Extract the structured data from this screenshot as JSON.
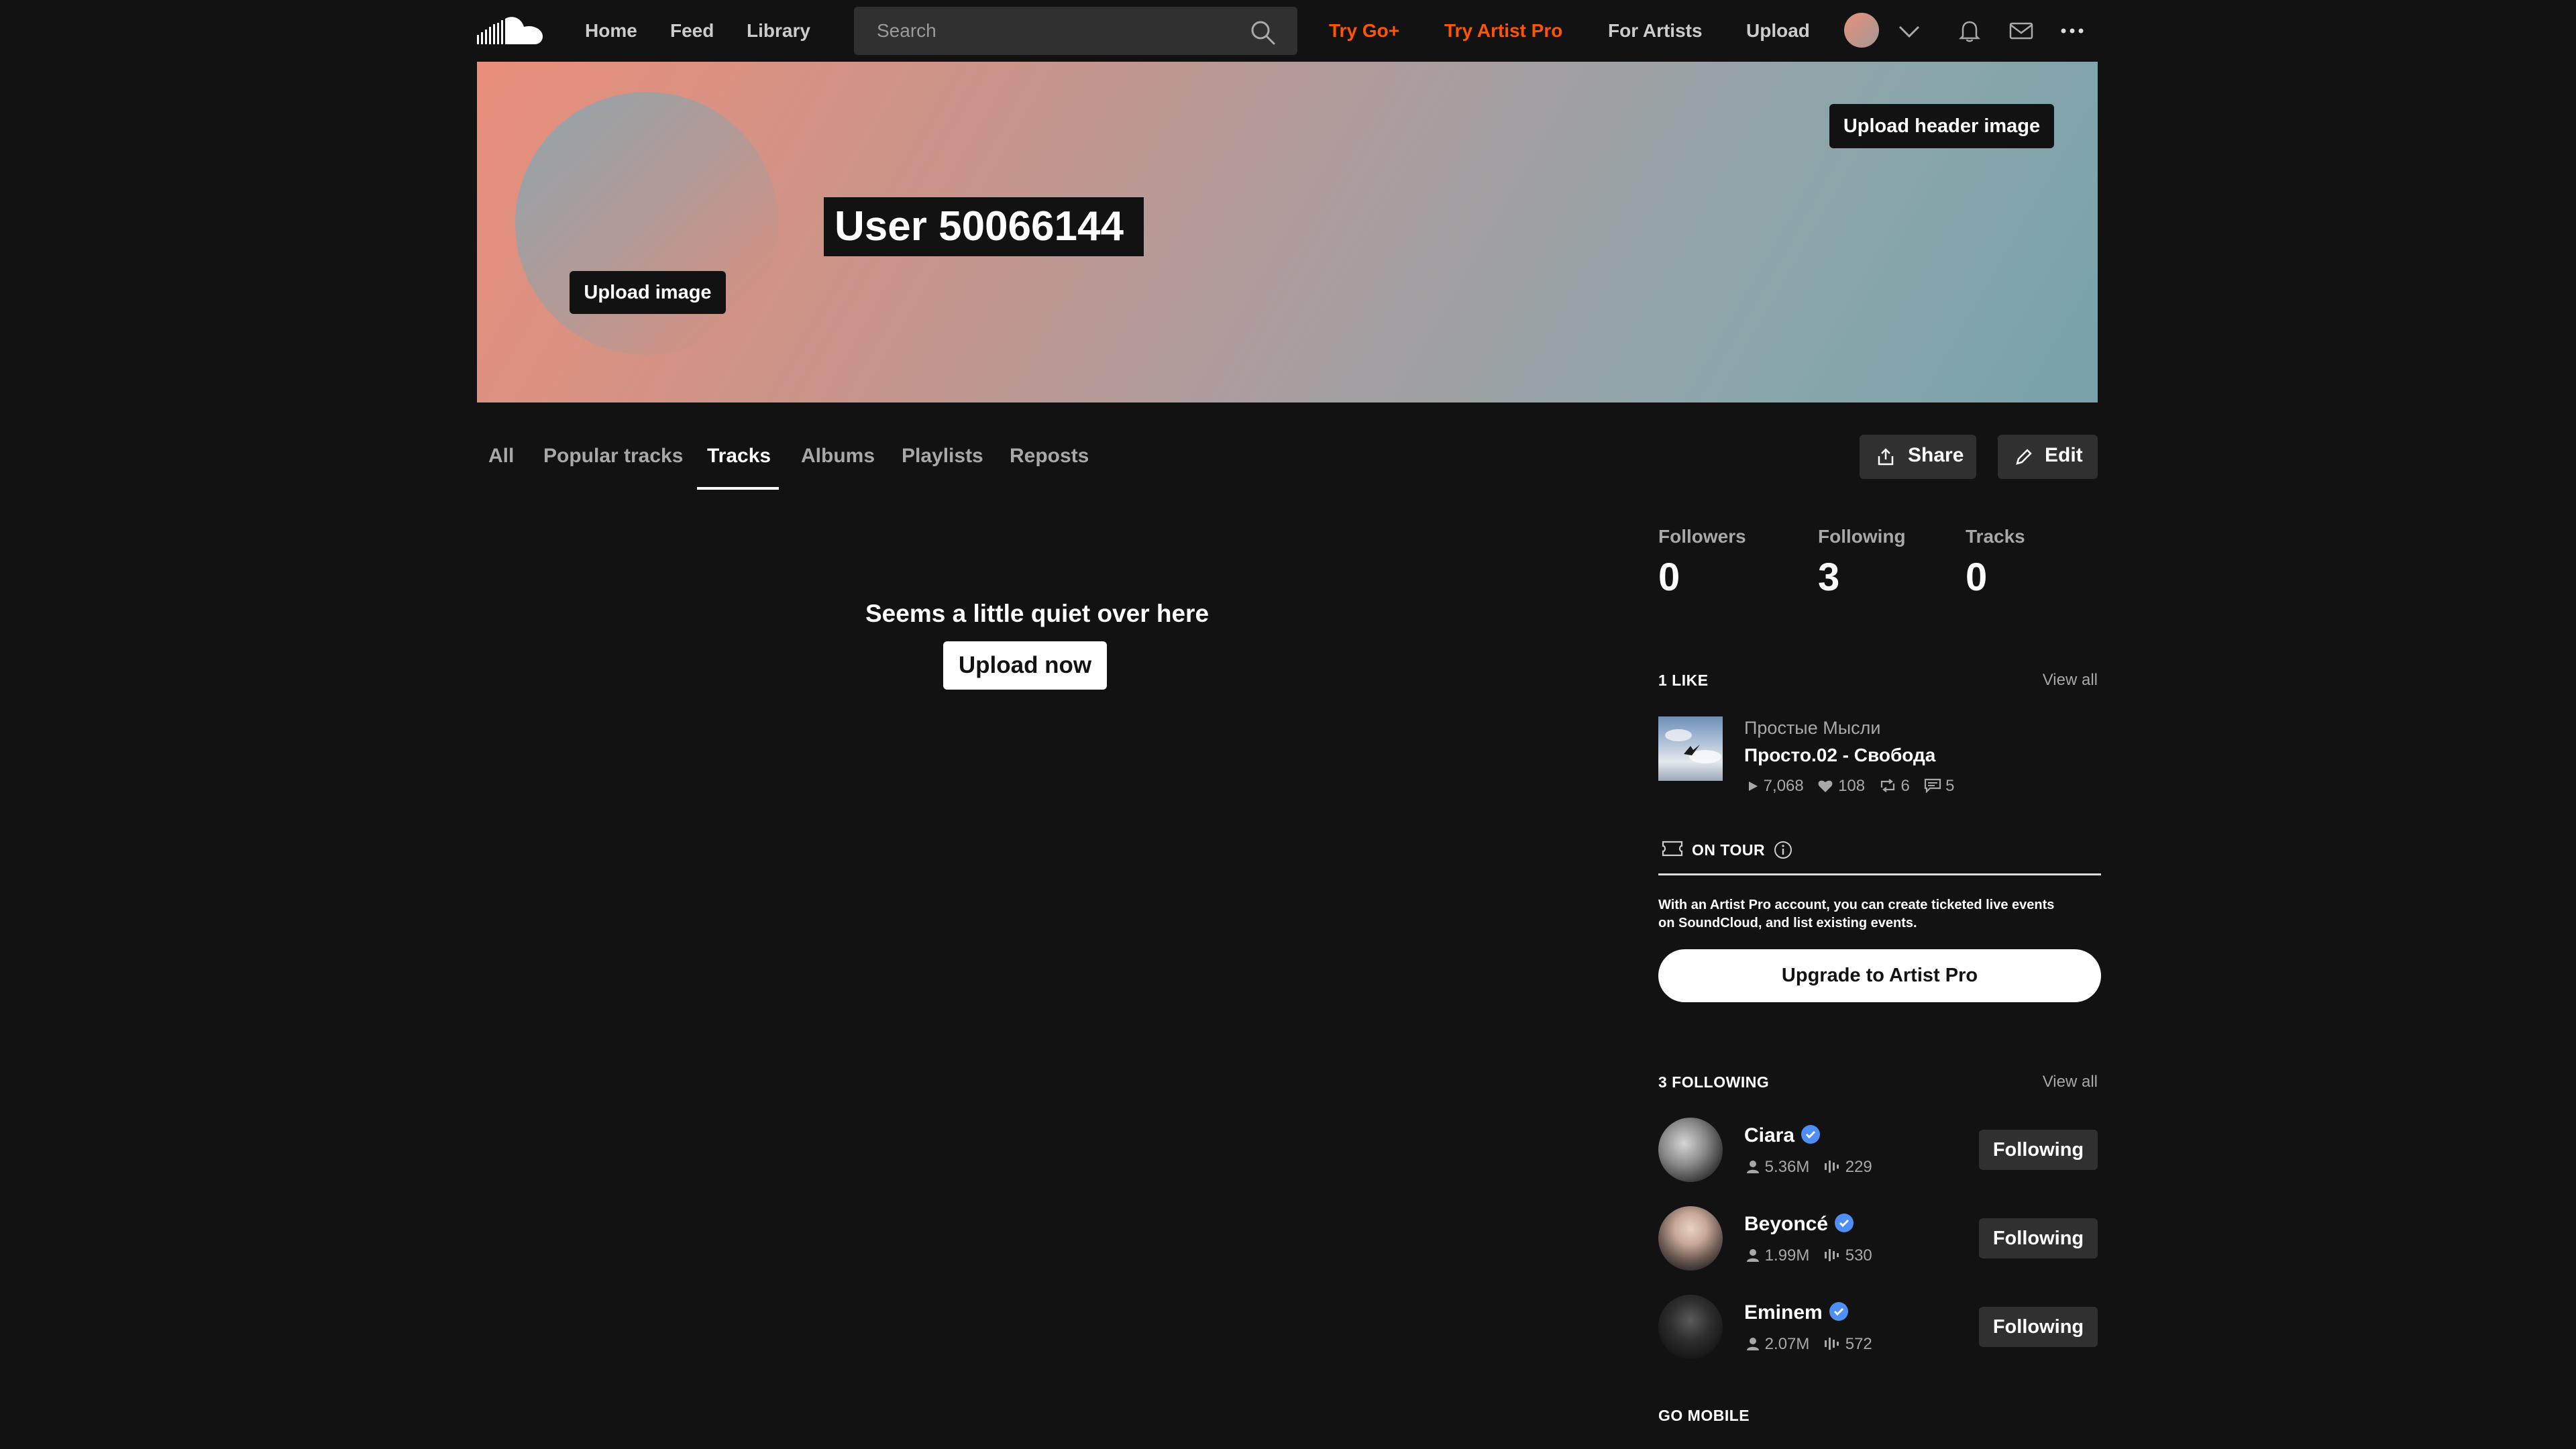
{
  "nav": {
    "home": "Home",
    "feed": "Feed",
    "library": "Library",
    "search_placeholder": "Search",
    "try_go": "Try Go+",
    "try_artist_pro": "Try Artist Pro",
    "for_artists": "For Artists",
    "upload": "Upload",
    "icons": [
      "soundcloud-logo-icon",
      "search-icon",
      "chevron-down-icon",
      "bell-icon",
      "mail-icon",
      "more-icon"
    ]
  },
  "header": {
    "upload_header_image": "Upload header image",
    "upload_image": "Upload image",
    "username": "User 50066144"
  },
  "tabs": [
    {
      "label": "All"
    },
    {
      "label": "Popular tracks"
    },
    {
      "label": "Tracks"
    },
    {
      "label": "Albums"
    },
    {
      "label": "Playlists"
    },
    {
      "label": "Reposts"
    }
  ],
  "active_tab": "Tracks",
  "actions": {
    "share": "Share",
    "edit": "Edit"
  },
  "empty": {
    "title": "Seems a little quiet over here",
    "button": "Upload now"
  },
  "stats": [
    {
      "label": "Followers",
      "value": "0"
    },
    {
      "label": "Following",
      "value": "3"
    },
    {
      "label": "Tracks",
      "value": "0"
    }
  ],
  "likes": {
    "title": "1 LIKE",
    "view_all": "View all",
    "track": {
      "artist": "Простые Мысли",
      "title": "Просто.02 - Свобода",
      "plays": "7,068",
      "likes": "108",
      "reposts": "6",
      "comments": "5"
    }
  },
  "tour": {
    "title": "ON TOUR",
    "text_line1": "With an Artist Pro account, you can create ticketed live events",
    "text_line2": "on SoundCloud, and list existing events.",
    "button": "Upgrade to Artist Pro"
  },
  "following": {
    "title": "3 FOLLOWING",
    "view_all": "View all",
    "button_label": "Following",
    "users": [
      {
        "name": "Ciara",
        "followers": "5.36M",
        "tracks": "229"
      },
      {
        "name": "Beyoncé",
        "followers": "1.99M",
        "tracks": "530"
      },
      {
        "name": "Eminem",
        "followers": "2.07M",
        "tracks": "572"
      }
    ]
  },
  "go_mobile": {
    "title": "GO MOBILE"
  },
  "colors": {
    "accent": "#ff5500",
    "background": "#121212",
    "verified": "#4f8ff5"
  }
}
